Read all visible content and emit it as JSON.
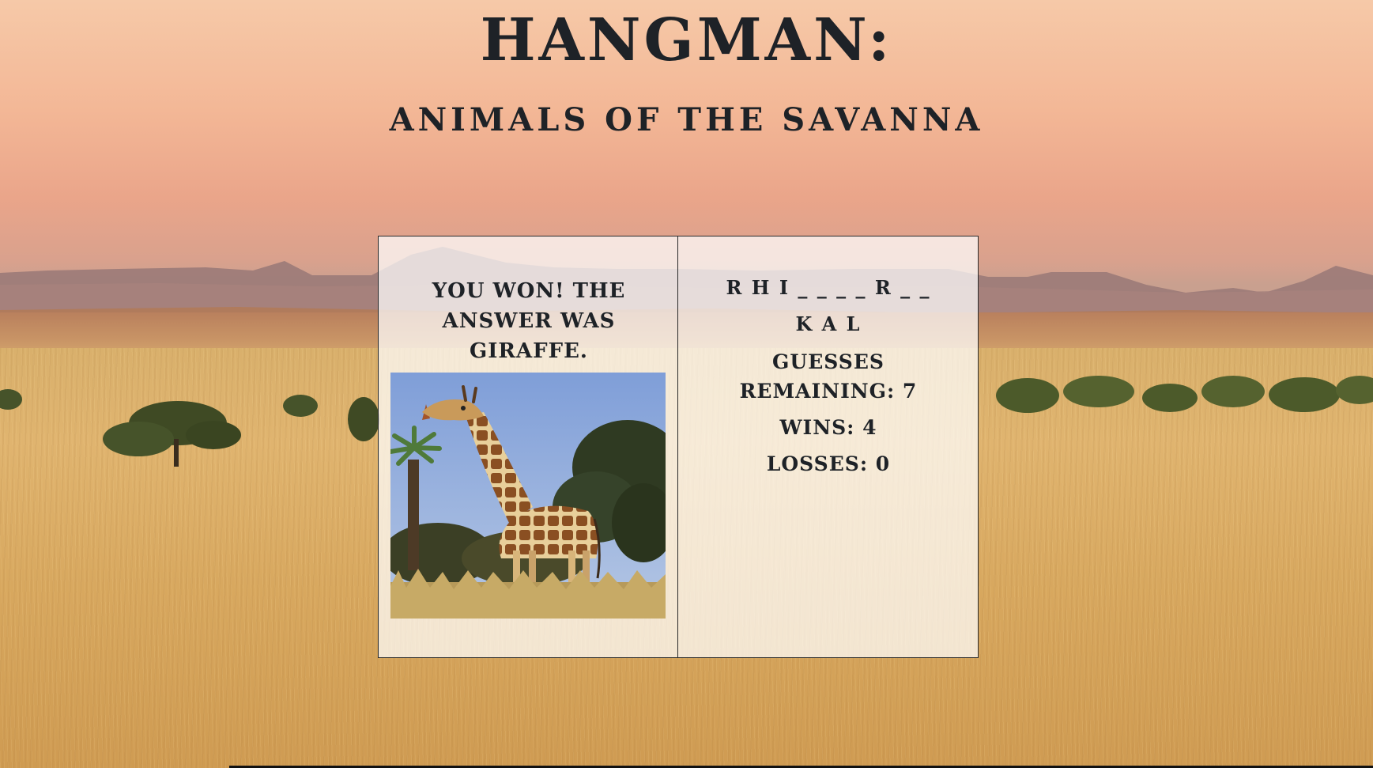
{
  "header": {
    "title": "HANGMAN:",
    "subtitle": "ANIMALS OF THE SAVANNA"
  },
  "result_panel": {
    "message": "YOU WON! THE ANSWER WAS GIRAFFE.",
    "image_alt": "giraffe"
  },
  "status_panel": {
    "word_line_1": "R H I _ _ _ _ R _ _",
    "word_line_2": "K A L",
    "guesses_remaining_label": "GUESSES REMAINING: 7",
    "wins_label": "WINS: 4",
    "losses_label": "LOSSES: 0"
  },
  "stats": {
    "guesses_remaining": 7,
    "wins": 4,
    "losses": 0
  },
  "colors": {
    "text": "#1e2227",
    "panel_bg": "rgba(255,255,255,0.72)",
    "sky_top": "#f6c9a8",
    "grass": "#d9b06c"
  }
}
